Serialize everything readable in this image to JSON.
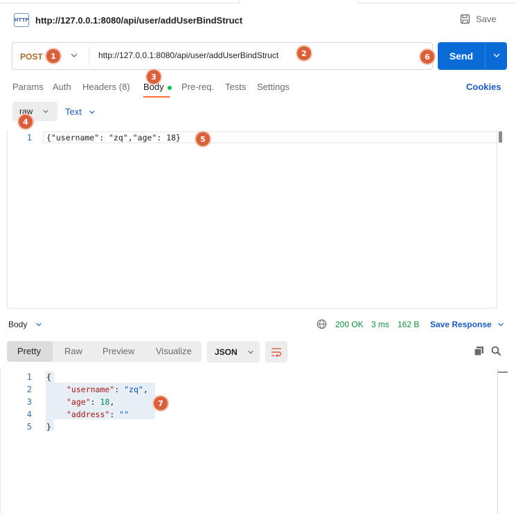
{
  "request": {
    "title": "http://127.0.0.1:8080/api/user/addUserBindStruct",
    "save_label": "Save",
    "method": "POST",
    "url": "http://127.0.0.1:8080/api/user/addUserBindStruct",
    "send_label": "Send"
  },
  "tabs": [
    {
      "label": "Params"
    },
    {
      "label": "Auth"
    },
    {
      "label": "Headers (8)"
    },
    {
      "label": "Body"
    },
    {
      "label": "Pre-req."
    },
    {
      "label": "Tests"
    },
    {
      "label": "Settings"
    }
  ],
  "cookies_label": "Cookies",
  "body_mode": {
    "raw_label": "raw",
    "text_label": "Text"
  },
  "request_editor": {
    "line_number": "1",
    "code": "{\"username\": \"zq\",\"age\": 18}"
  },
  "response": {
    "body_label": "Body",
    "status": "200 OK",
    "time": "3 ms",
    "size": "162 B",
    "save_response_label": "Save Response",
    "view_tabs": [
      "Pretty",
      "Raw",
      "Preview",
      "Visualize"
    ],
    "format": "JSON",
    "lines": [
      "1",
      "2",
      "3",
      "4",
      "5"
    ],
    "json": {
      "open": "{",
      "username_key": "\"username\"",
      "username_val": "\"zq\"",
      "age_key": "\"age\"",
      "age_val": "18",
      "address_key": "\"address\"",
      "address_val": "\"\"",
      "close": "}"
    }
  },
  "markers": [
    "1",
    "2",
    "3",
    "4",
    "5",
    "6",
    "7"
  ],
  "colors": {
    "accent": "#0b6bd6",
    "method": "#a9652b",
    "marker": "#d9603b",
    "status_ok": "#0f8a3f",
    "link": "#1c5bb8"
  }
}
